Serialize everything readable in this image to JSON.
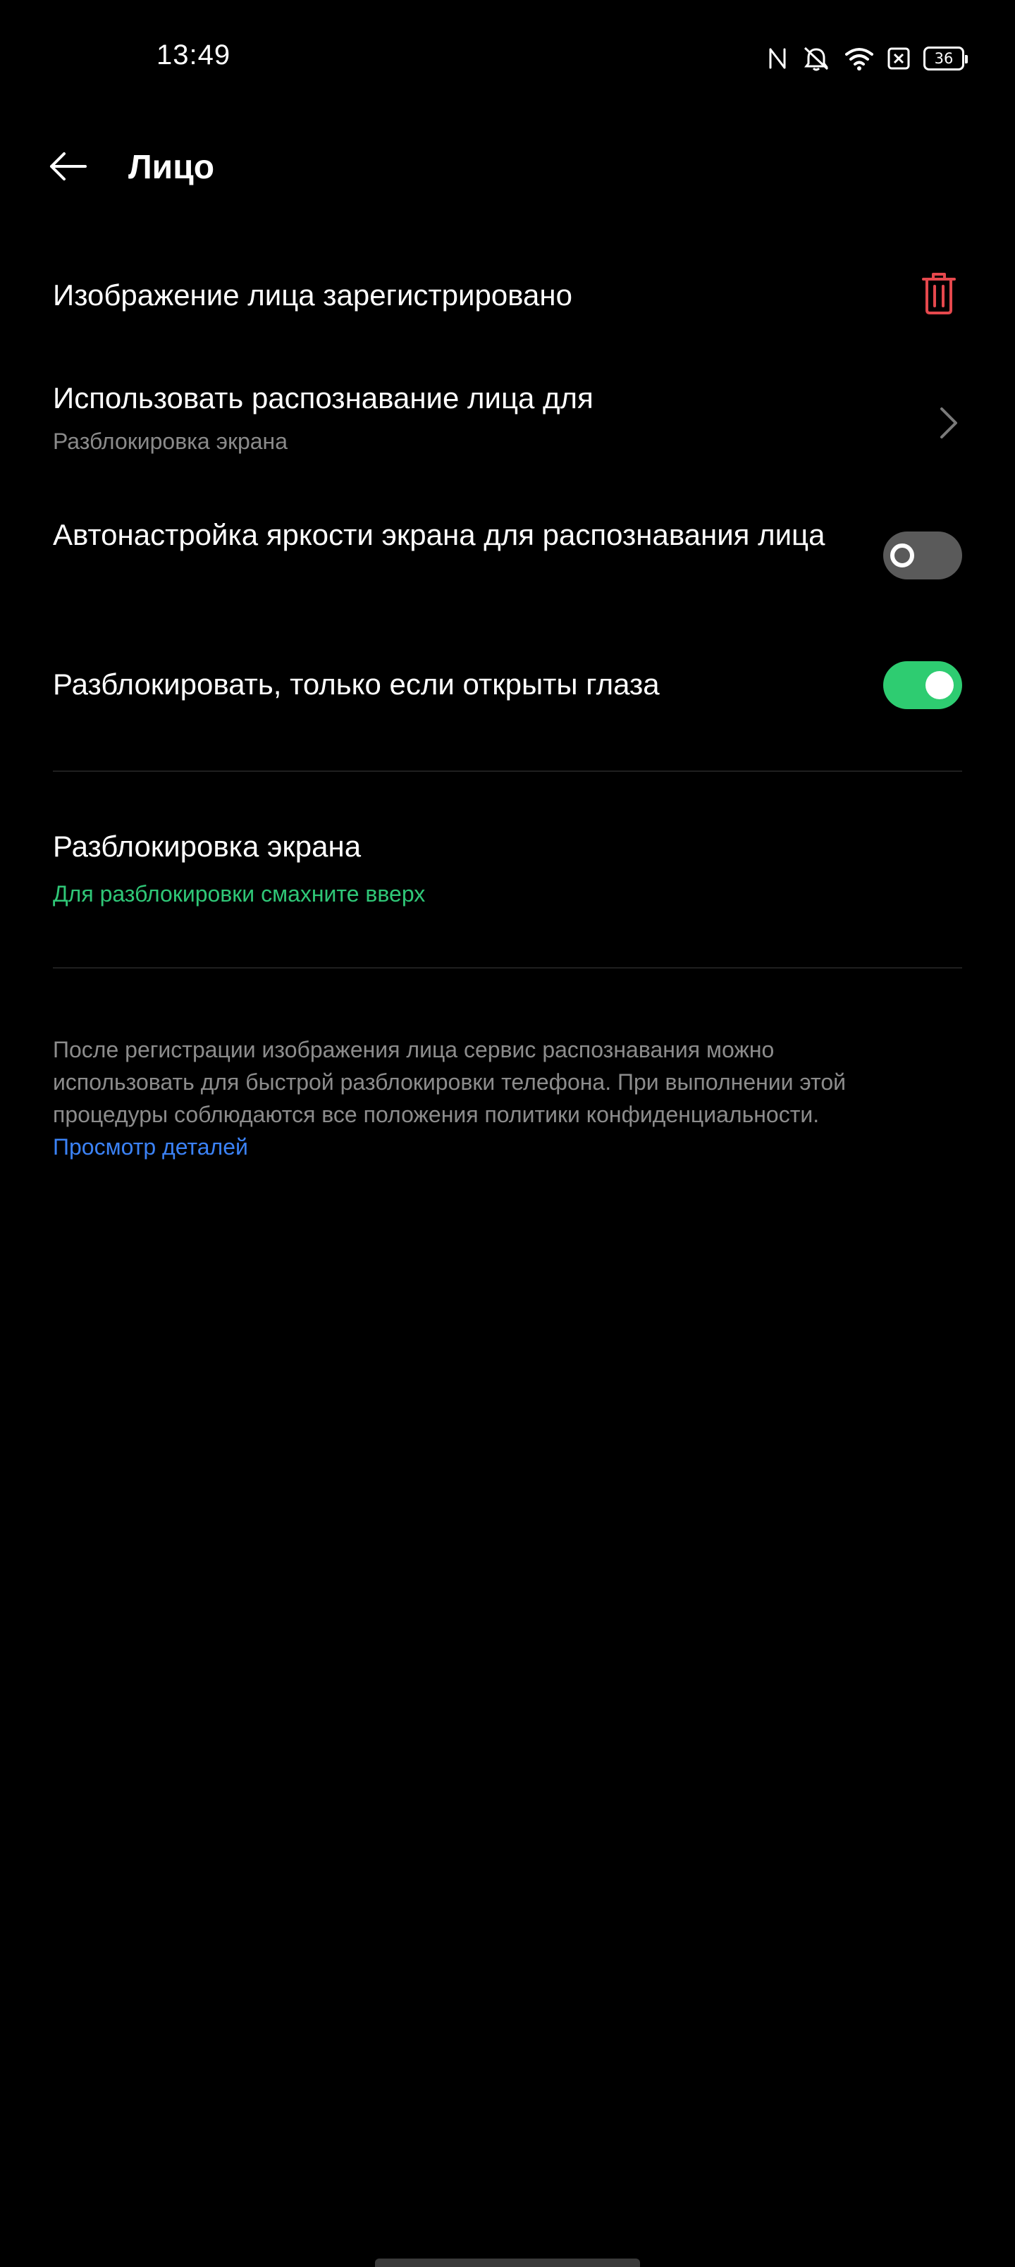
{
  "status_bar": {
    "time": "13:49",
    "icons": [
      "nfc-icon",
      "silent-bell-icon",
      "wifi-icon",
      "sim-disabled-icon",
      "battery-icon"
    ],
    "battery_level": "36"
  },
  "header": {
    "title": "Лицо",
    "back_icon": "back-arrow-icon"
  },
  "settings": {
    "face_registered": {
      "title": "Изображение лица зарегистрировано",
      "action_icon": "trash-icon",
      "action_color": "#e5484d"
    },
    "use_for": {
      "title": "Использовать распознавание лица для",
      "subtitle": "Разблокировка экрана",
      "action_icon": "chevron-right-icon"
    },
    "auto_brightness": {
      "title": "Автонастройка яркости экрана для распознавания лица",
      "enabled": false
    },
    "eyes_open": {
      "title": "Разблокировать, только если открыты глаза",
      "enabled": true,
      "accent_color": "#2ecc71"
    },
    "screen_unlock": {
      "title": "Разблокировка экрана",
      "subtitle": "Для разблокировки смахните вверх",
      "subtitle_color": "#2fc777"
    }
  },
  "info": {
    "text": "После регистрации изображения лица сервис распознавания можно использовать для быстрой разблокировки телефона. При выполнении этой процедуры соблюдаются все положения политики конфиденциальности. ",
    "link_text": "Просмотр деталей",
    "link_color": "#3b82f6"
  }
}
